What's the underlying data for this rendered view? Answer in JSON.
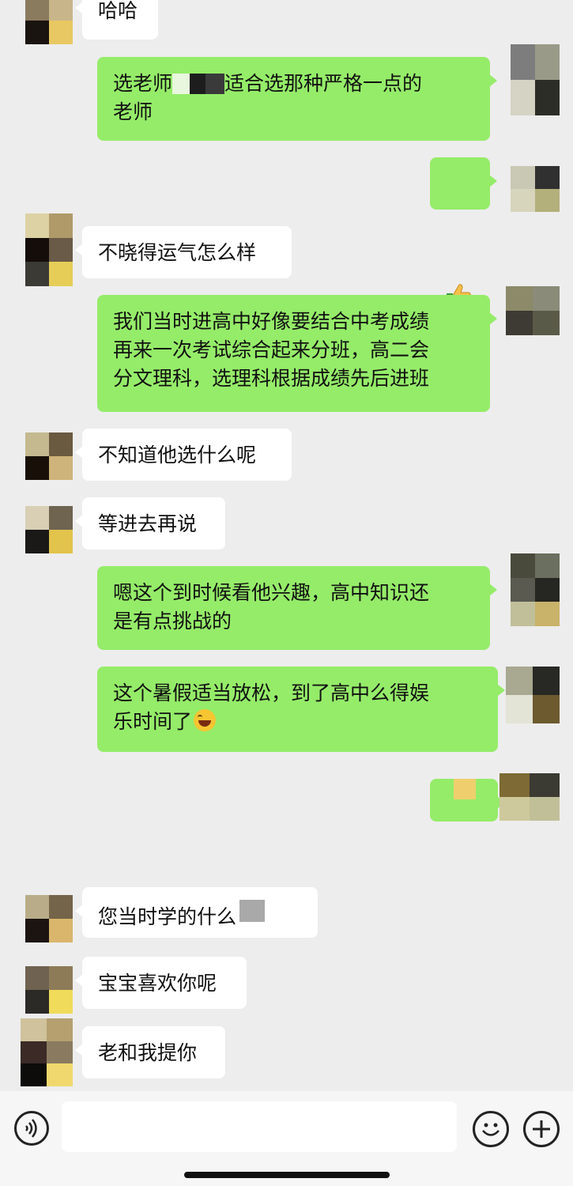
{
  "colors": {
    "background": "#ededed",
    "bubble_self": "#95ec69",
    "bubble_other": "#ffffff",
    "text": "#111111"
  },
  "messages": [
    {
      "side": "left",
      "text": "哈哈"
    },
    {
      "side": "right",
      "text_before": "选老师",
      "text_after": "适合选那种严格一点的\n老师"
    },
    {
      "side": "right",
      "icon": "thumbs-up-emoji"
    },
    {
      "side": "left",
      "text": "不晓得运气怎么样"
    },
    {
      "side": "right",
      "text": "我们当时进高中好像要结合中考成绩\n再来一次考试综合起来分班，高二会\n分文理科，选理科根据成绩先后进班"
    },
    {
      "side": "left",
      "text": "不知道他选什么呢"
    },
    {
      "side": "left",
      "text": "等进去再说"
    },
    {
      "side": "right",
      "text": "嗯这个到时候看他兴趣，高中知识还\n是有点挑战的"
    },
    {
      "side": "right",
      "text": "这个暑假适当放松，到了高中么得娱\n乐时间了",
      "icon": "laughing-tears-emoji"
    },
    {
      "side": "right",
      "text": ""
    },
    {
      "side": "left",
      "text": "您当时学的什么"
    },
    {
      "side": "left",
      "text": "宝宝喜欢你呢"
    },
    {
      "side": "left",
      "text": "老和我提你"
    }
  ],
  "input_bar": {
    "voice_icon": "voice-icon",
    "emoji_icon": "emoji-icon",
    "plus_icon": "plus-icon"
  }
}
